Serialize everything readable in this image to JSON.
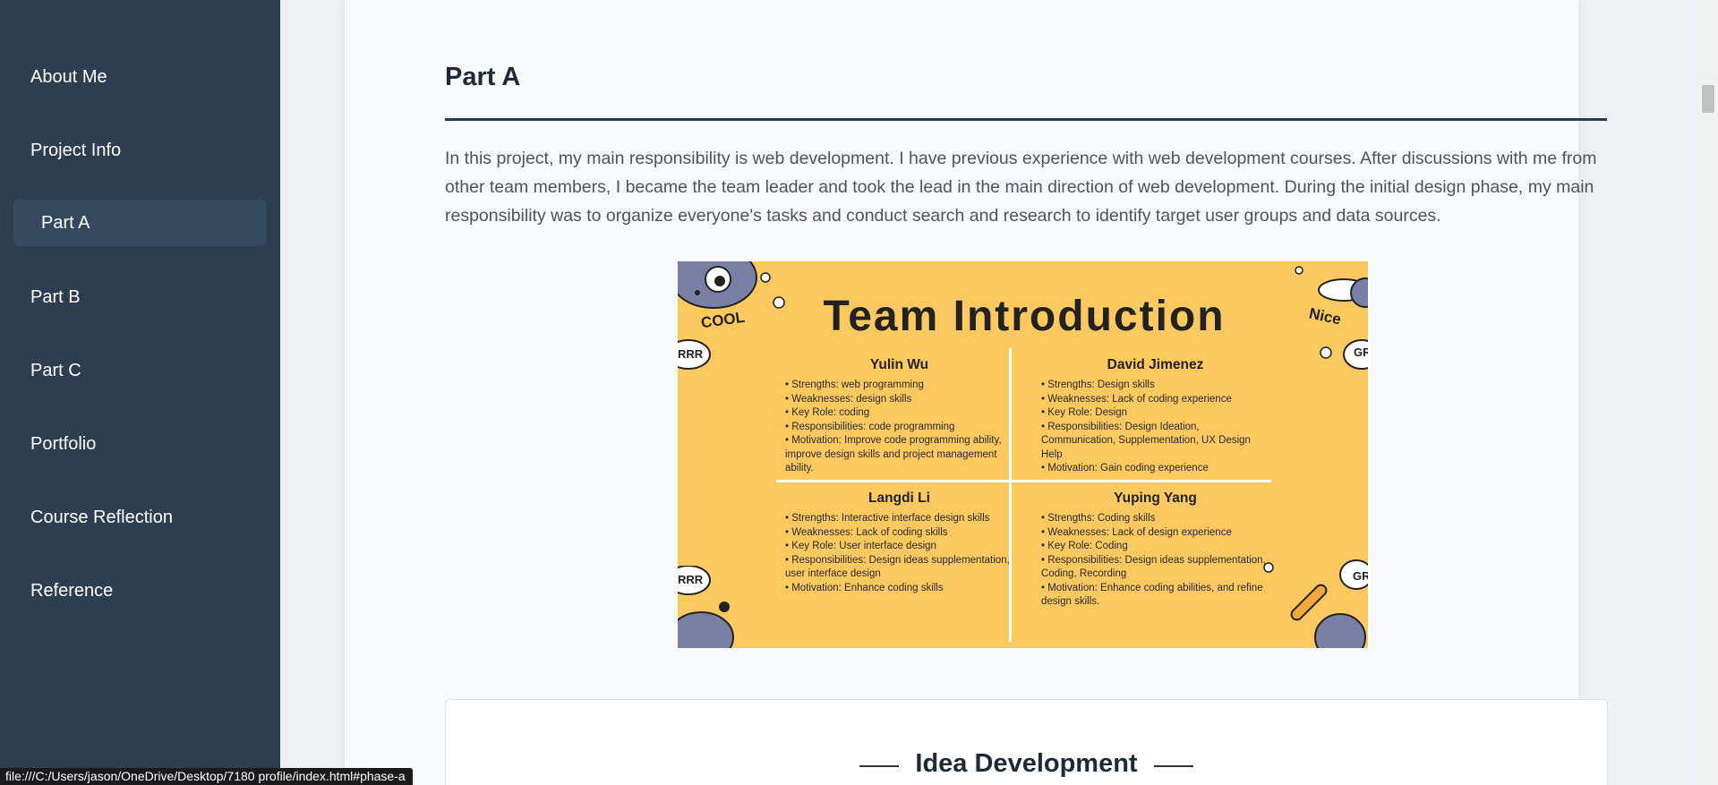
{
  "sidebar": {
    "items": [
      {
        "label": "About Me"
      },
      {
        "label": "Project Info"
      },
      {
        "label": "Part A"
      },
      {
        "label": "Part B"
      },
      {
        "label": "Part C"
      },
      {
        "label": "Portfolio"
      },
      {
        "label": "Course Reflection"
      },
      {
        "label": "Reference"
      }
    ]
  },
  "main": {
    "part_title": "Part A",
    "intro": "In this project, my main responsibility is web development. I have previous experience with web development courses. After discussions with me from other team members, I became the team leader and took the lead in the main direction of web development. During the initial design phase, my main responsibility was to organize everyone's tasks and conduct search and research to identify target user groups and data sources.",
    "poster": {
      "title": "Team Introduction",
      "stickers": [
        "COOL",
        "Nice",
        "RRR",
        "GR"
      ],
      "members": [
        {
          "name": "Yulin Wu",
          "lines": [
            "• Strengths: web programming",
            "• Weaknesses: design skills",
            "• Key Role: coding",
            "• Responsibilities: code programming",
            "• Motivation: Improve code programming ability, improve design skills and project management ability."
          ]
        },
        {
          "name": "David Jimenez",
          "lines": [
            "• Strengths: Design skills",
            "• Weaknesses: Lack of coding experience",
            "• Key Role: Design",
            "• Responsibilities: Design Ideation, Communication, Supplementation, UX Design Help",
            "• Motivation: Gain coding experience"
          ]
        },
        {
          "name": "Langdi Li",
          "lines": [
            "• Strengths: Interactive interface design skills",
            "• Weaknesses: Lack of coding skills",
            "• Key Role: User interface design",
            "• Responsibilities: Design ideas supplementation, user interface design",
            "• Motivation: Enhance coding skills"
          ]
        },
        {
          "name": "Yuping Yang",
          "lines": [
            "• Strengths: Coding skills",
            "• Weaknesses: Lack of design experience",
            "• Key Role: Coding",
            "• Responsibilities: Design ideas supplementation, Coding, Recording",
            "• Motivation: Enhance coding abilities, and refine design skills."
          ]
        }
      ]
    },
    "idea_title": "Idea Development"
  },
  "status_bar": {
    "url": "file:///C:/Users/jason/OneDrive/Desktop/7180 profile/index.html#phase-a"
  },
  "colors": {
    "sidebar": "#2c3e50",
    "active_item": "#34495e",
    "accent_rule": "#1f3a63",
    "poster_bg": "#fcc860"
  },
  "icons": [
    "cartoon-dog-icon",
    "paw-print-icon",
    "bone-icon",
    "dog-collar-icon",
    "speech-bubble-icon"
  ]
}
